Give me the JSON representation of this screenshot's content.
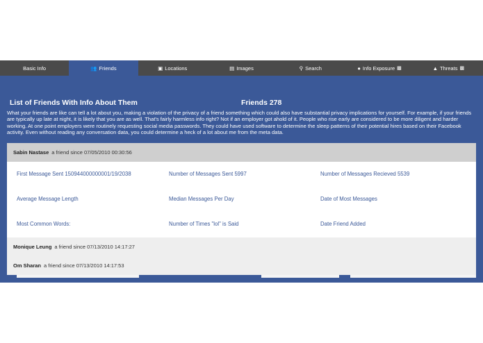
{
  "nav": {
    "tabs": [
      {
        "label": "Basic Info",
        "icon": "",
        "lock": false,
        "active": false
      },
      {
        "label": "Friends",
        "icon": "users-icon",
        "lock": false,
        "active": true
      },
      {
        "label": "Locations",
        "icon": "building-icon",
        "lock": false,
        "active": false
      },
      {
        "label": "Images",
        "icon": "images-icon",
        "lock": false,
        "active": false
      },
      {
        "label": "Search",
        "icon": "search-icon",
        "lock": false,
        "active": false
      },
      {
        "label": "Info Exposure",
        "icon": "globe-icon",
        "lock": true,
        "active": false
      },
      {
        "label": "Threats",
        "icon": "warning-icon",
        "lock": true,
        "active": false
      }
    ]
  },
  "main": {
    "title": "List of Friends With Info About Them",
    "friends_count": "Friends 278",
    "description": "What your friends are like can tell a lot about you, making a violation of the privacy of a friend something which could also have substantial privacy implications for yourself. For example, if your friends are typically up late at night, it is likely that you are as well. That's fairly harmless info right? Not if an employer got ahold of it. People who rise early are considered to be more diligent and harder working. At one point employers were routinely requesting social media passwords. They could have used software to determine the sleep patterns of their potential hires based on their Facebook activity. Even without reading any conversation data, you could determine a heck of a lot about me from the meta data."
  },
  "friends": {
    "expanded": {
      "name": "Sabin Nastase",
      "since": "a friend since 07/05/2010 00:30:56",
      "stats": [
        "First Message Sent 150944000000001/19/2038",
        "Number of Messages Sent 5997",
        "Number of Messages Recieved 5539",
        "Average Message Length",
        "Median Messages Per Day",
        "Date of Most Messages",
        "Most Common Words:",
        "Number of Times \"lol\" is Said",
        "Date Friend Added"
      ]
    },
    "others": [
      {
        "name": "Monique Leung",
        "since": "a friend since 07/13/2010 14:17:27"
      },
      {
        "name": "Om Sharan",
        "since": "a friend since 07/13/2010 14:17:53"
      }
    ]
  },
  "colors": {
    "nav_bg": "#4a4a4a",
    "accent": "#3b5998",
    "link": "#3b5998"
  }
}
